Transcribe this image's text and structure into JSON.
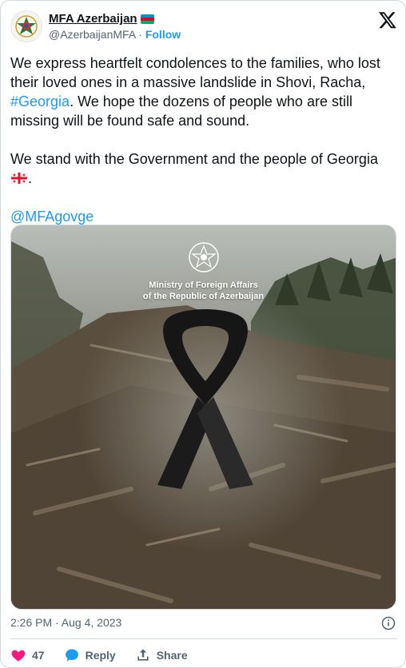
{
  "author": {
    "display_name": "MFA Azerbaijan",
    "handle": "@AzerbaijanMFA",
    "separator": "·",
    "follow_label": "Follow",
    "avatar_icon": "coat-of-arms-icon",
    "flag_icon": "azerbaijan-flag-icon"
  },
  "tweet": {
    "paragraph1_a": "We express heartfelt condolences to the families, who lost their loved ones in a massive landslide in Shovi, Racha, ",
    "hashtag": "#Georgia",
    "paragraph1_b": ". We hope the dozens of people who are still missing will be found safe and sound.",
    "paragraph2": "We stand with the Government and the people of Georgia",
    "paragraph2_end": ".",
    "mention": "@MFAgovge"
  },
  "media": {
    "caption_line1": "Ministry of Foreign Affairs",
    "caption_line2": "of the Republic of Azerbaijan",
    "description_icon": "black-ribbon-icon"
  },
  "footer": {
    "timestamp": "2:26 PM · Aug 4, 2023",
    "likes_count": "47",
    "reply_label": "Reply",
    "share_label": "Share"
  },
  "colors": {
    "accent": "#1d9bf0",
    "like": "#f91880",
    "muted": "#536471",
    "text": "#0f1419"
  }
}
